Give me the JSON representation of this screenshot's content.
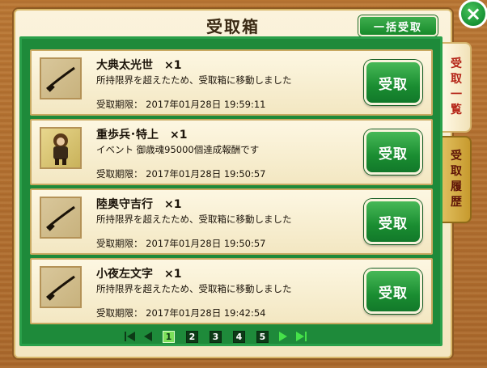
{
  "dialog": {
    "title": "受取箱",
    "bulk_receive_label": "一括受取",
    "close_label": "×"
  },
  "tabs": [
    {
      "label": "受取一覧",
      "chars": [
        "受",
        "取",
        "一",
        "覧"
      ],
      "active": true
    },
    {
      "label": "受取履歴",
      "chars": [
        "受",
        "取",
        "履",
        "歴"
      ],
      "active": false
    }
  ],
  "items": [
    {
      "name": "大典太光世　×1",
      "description": "所持限界を超えたため、受取箱に移動しました",
      "deadline": "受取期限：  2017年01月28日 19:59:11",
      "button": "受取",
      "icon": "katana-icon"
    },
    {
      "name": "重歩兵･特上　×1",
      "description": "イベント 御歳魂95000個達成報酬です",
      "deadline": "受取期限：  2017年01月28日 19:50:57",
      "button": "受取",
      "icon": "heavy-infantry-icon"
    },
    {
      "name": "陸奥守吉行　×1",
      "description": "所持限界を超えたため、受取箱に移動しました",
      "deadline": "受取期限：  2017年01月28日 19:50:57",
      "button": "受取",
      "icon": "katana-icon"
    },
    {
      "name": "小夜左文字　×1",
      "description": "所持限界を超えたため、受取箱に移動しました",
      "deadline": "受取期限：  2017年01月28日 19:42:54",
      "button": "受取",
      "icon": "katana-icon"
    }
  ],
  "pagination": {
    "pages": [
      "1",
      "2",
      "3",
      "4",
      "5"
    ],
    "current": "1"
  },
  "colors": {
    "accent_green": "#1a8d31",
    "panel_bg": "#f8efd2",
    "tab_active_text": "#b42316"
  }
}
